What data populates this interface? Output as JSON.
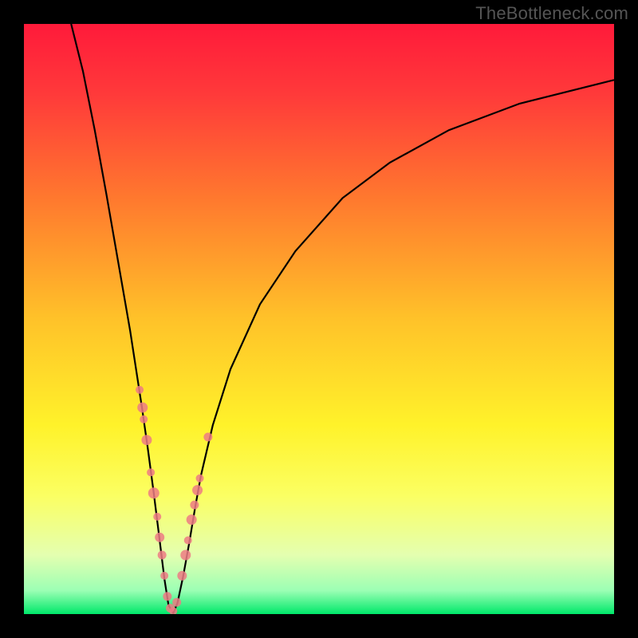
{
  "watermark": "TheBottleneck.com",
  "chart_data": {
    "type": "line",
    "title": "",
    "xlabel": "",
    "ylabel": "",
    "xlim": [
      0,
      100
    ],
    "ylim": [
      0,
      100
    ],
    "gradient_stops": [
      {
        "offset": 0.0,
        "color": "#ff1a3a"
      },
      {
        "offset": 0.12,
        "color": "#ff3a3a"
      },
      {
        "offset": 0.3,
        "color": "#ff7a2e"
      },
      {
        "offset": 0.5,
        "color": "#ffc229"
      },
      {
        "offset": 0.68,
        "color": "#fff22a"
      },
      {
        "offset": 0.8,
        "color": "#fbff63"
      },
      {
        "offset": 0.9,
        "color": "#e4ffb0"
      },
      {
        "offset": 0.96,
        "color": "#9cffb4"
      },
      {
        "offset": 1.0,
        "color": "#00e86a"
      }
    ],
    "series": [
      {
        "name": "bottleneck-curve",
        "x": [
          8.0,
          10.0,
          12.0,
          14.0,
          16.0,
          18.0,
          20.0,
          21.0,
          22.0,
          23.0,
          23.8,
          24.5,
          25.3,
          26.0,
          27.0,
          28.0,
          29.0,
          30.0,
          32.0,
          35.0,
          40.0,
          46.0,
          54.0,
          62.0,
          72.0,
          84.0,
          100.0
        ],
        "y": [
          100.0,
          92.0,
          82.0,
          71.0,
          59.5,
          48.0,
          35.0,
          28.0,
          20.5,
          12.5,
          6.0,
          1.5,
          0.2,
          1.8,
          6.5,
          12.0,
          18.0,
          23.5,
          32.0,
          41.5,
          52.5,
          61.5,
          70.5,
          76.5,
          82.0,
          86.5,
          90.5
        ]
      }
    ],
    "scatter": {
      "name": "measured-points",
      "color": "#ed7b84",
      "x": [
        19.6,
        20.1,
        20.3,
        20.8,
        21.5,
        22.0,
        22.6,
        23.0,
        23.4,
        23.8,
        24.3,
        24.8,
        25.3,
        25.9,
        26.8,
        27.4,
        27.8,
        28.4,
        28.9,
        29.4,
        29.8,
        31.2
      ],
      "y": [
        38.0,
        35.0,
        33.0,
        29.5,
        24.0,
        20.5,
        16.5,
        13.0,
        10.0,
        6.5,
        3.0,
        1.0,
        0.5,
        2.0,
        6.5,
        10.0,
        12.5,
        16.0,
        18.5,
        21.0,
        23.0,
        30.0
      ],
      "r": [
        5.0,
        6.5,
        5.0,
        6.5,
        5.0,
        7.0,
        5.0,
        6.0,
        5.5,
        5.0,
        5.5,
        5.5,
        5.0,
        5.5,
        6.0,
        6.5,
        5.0,
        6.5,
        5.5,
        6.5,
        5.0,
        5.5
      ]
    }
  }
}
